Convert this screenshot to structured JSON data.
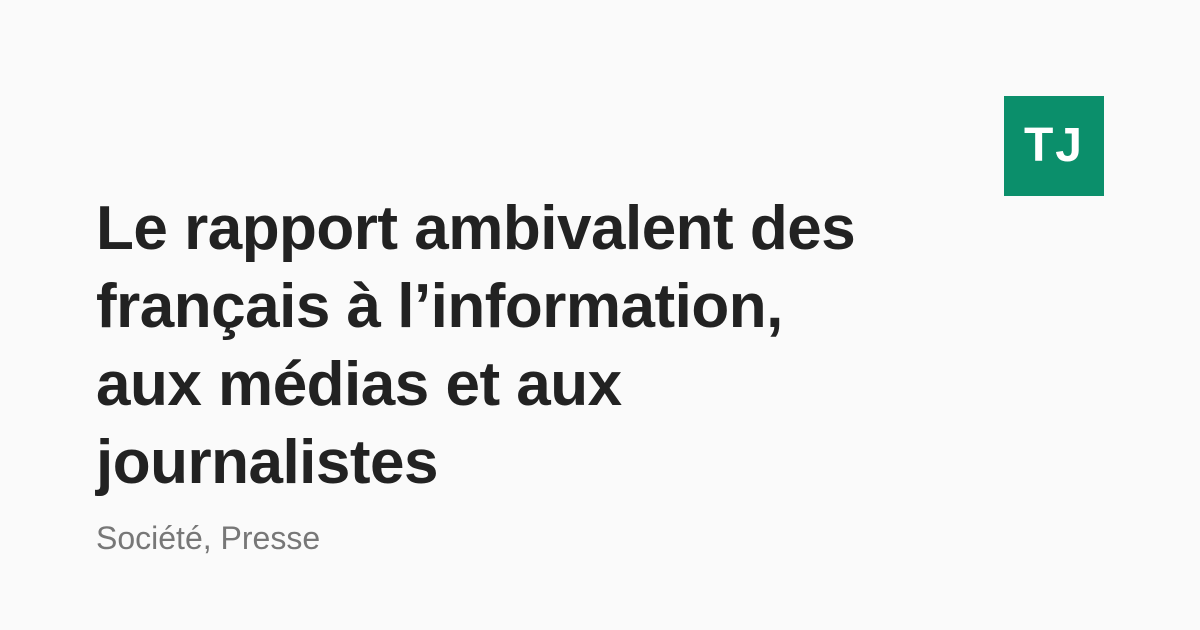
{
  "logo": {
    "text": "TJ",
    "color": "#0b8f6b"
  },
  "article": {
    "title_lines": [
      "Le rapport ambivalent des",
      "français à l’information,",
      "aux médias et aux",
      "journalistes"
    ],
    "tags": "Société, Presse"
  },
  "colors": {
    "background": "#fafafa",
    "title": "#222222",
    "tags": "#777777"
  }
}
